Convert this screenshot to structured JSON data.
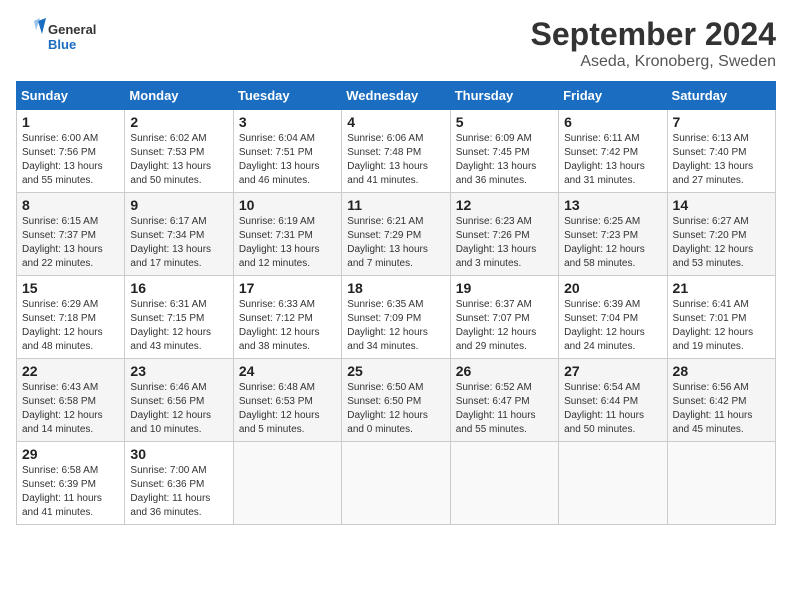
{
  "logo": {
    "text_general": "General",
    "text_blue": "Blue"
  },
  "title": "September 2024",
  "subtitle": "Aseda, Kronoberg, Sweden",
  "days_of_week": [
    "Sunday",
    "Monday",
    "Tuesday",
    "Wednesday",
    "Thursday",
    "Friday",
    "Saturday"
  ],
  "weeks": [
    [
      {
        "day": "1",
        "sunrise": "6:00 AM",
        "sunset": "7:56 PM",
        "daylight": "13 hours and 55 minutes."
      },
      {
        "day": "2",
        "sunrise": "6:02 AM",
        "sunset": "7:53 PM",
        "daylight": "13 hours and 50 minutes."
      },
      {
        "day": "3",
        "sunrise": "6:04 AM",
        "sunset": "7:51 PM",
        "daylight": "13 hours and 46 minutes."
      },
      {
        "day": "4",
        "sunrise": "6:06 AM",
        "sunset": "7:48 PM",
        "daylight": "13 hours and 41 minutes."
      },
      {
        "day": "5",
        "sunrise": "6:09 AM",
        "sunset": "7:45 PM",
        "daylight": "13 hours and 36 minutes."
      },
      {
        "day": "6",
        "sunrise": "6:11 AM",
        "sunset": "7:42 PM",
        "daylight": "13 hours and 31 minutes."
      },
      {
        "day": "7",
        "sunrise": "6:13 AM",
        "sunset": "7:40 PM",
        "daylight": "13 hours and 27 minutes."
      }
    ],
    [
      {
        "day": "8",
        "sunrise": "6:15 AM",
        "sunset": "7:37 PM",
        "daylight": "13 hours and 22 minutes."
      },
      {
        "day": "9",
        "sunrise": "6:17 AM",
        "sunset": "7:34 PM",
        "daylight": "13 hours and 17 minutes."
      },
      {
        "day": "10",
        "sunrise": "6:19 AM",
        "sunset": "7:31 PM",
        "daylight": "13 hours and 12 minutes."
      },
      {
        "day": "11",
        "sunrise": "6:21 AM",
        "sunset": "7:29 PM",
        "daylight": "13 hours and 7 minutes."
      },
      {
        "day": "12",
        "sunrise": "6:23 AM",
        "sunset": "7:26 PM",
        "daylight": "13 hours and 3 minutes."
      },
      {
        "day": "13",
        "sunrise": "6:25 AM",
        "sunset": "7:23 PM",
        "daylight": "12 hours and 58 minutes."
      },
      {
        "day": "14",
        "sunrise": "6:27 AM",
        "sunset": "7:20 PM",
        "daylight": "12 hours and 53 minutes."
      }
    ],
    [
      {
        "day": "15",
        "sunrise": "6:29 AM",
        "sunset": "7:18 PM",
        "daylight": "12 hours and 48 minutes."
      },
      {
        "day": "16",
        "sunrise": "6:31 AM",
        "sunset": "7:15 PM",
        "daylight": "12 hours and 43 minutes."
      },
      {
        "day": "17",
        "sunrise": "6:33 AM",
        "sunset": "7:12 PM",
        "daylight": "12 hours and 38 minutes."
      },
      {
        "day": "18",
        "sunrise": "6:35 AM",
        "sunset": "7:09 PM",
        "daylight": "12 hours and 34 minutes."
      },
      {
        "day": "19",
        "sunrise": "6:37 AM",
        "sunset": "7:07 PM",
        "daylight": "12 hours and 29 minutes."
      },
      {
        "day": "20",
        "sunrise": "6:39 AM",
        "sunset": "7:04 PM",
        "daylight": "12 hours and 24 minutes."
      },
      {
        "day": "21",
        "sunrise": "6:41 AM",
        "sunset": "7:01 PM",
        "daylight": "12 hours and 19 minutes."
      }
    ],
    [
      {
        "day": "22",
        "sunrise": "6:43 AM",
        "sunset": "6:58 PM",
        "daylight": "12 hours and 14 minutes."
      },
      {
        "day": "23",
        "sunrise": "6:46 AM",
        "sunset": "6:56 PM",
        "daylight": "12 hours and 10 minutes."
      },
      {
        "day": "24",
        "sunrise": "6:48 AM",
        "sunset": "6:53 PM",
        "daylight": "12 hours and 5 minutes."
      },
      {
        "day": "25",
        "sunrise": "6:50 AM",
        "sunset": "6:50 PM",
        "daylight": "12 hours and 0 minutes."
      },
      {
        "day": "26",
        "sunrise": "6:52 AM",
        "sunset": "6:47 PM",
        "daylight": "11 hours and 55 minutes."
      },
      {
        "day": "27",
        "sunrise": "6:54 AM",
        "sunset": "6:44 PM",
        "daylight": "11 hours and 50 minutes."
      },
      {
        "day": "28",
        "sunrise": "6:56 AM",
        "sunset": "6:42 PM",
        "daylight": "11 hours and 45 minutes."
      }
    ],
    [
      {
        "day": "29",
        "sunrise": "6:58 AM",
        "sunset": "6:39 PM",
        "daylight": "11 hours and 41 minutes."
      },
      {
        "day": "30",
        "sunrise": "7:00 AM",
        "sunset": "6:36 PM",
        "daylight": "11 hours and 36 minutes."
      },
      null,
      null,
      null,
      null,
      null
    ]
  ]
}
